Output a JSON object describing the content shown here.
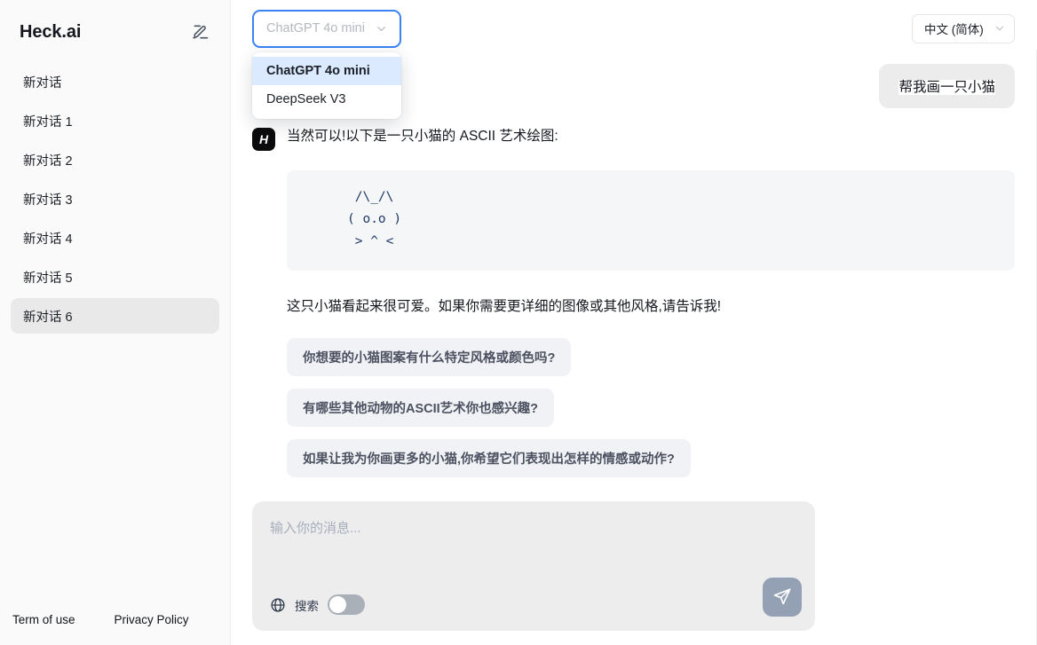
{
  "sidebar": {
    "brand": "Heck.ai",
    "compose_icon": "square-pen-icon",
    "conversations": [
      {
        "label": "新对话",
        "active": false
      },
      {
        "label": "新对话 1",
        "active": false
      },
      {
        "label": "新对话 2",
        "active": false
      },
      {
        "label": "新对话 3",
        "active": false
      },
      {
        "label": "新对话 4",
        "active": false
      },
      {
        "label": "新对话 5",
        "active": false
      },
      {
        "label": "新对话 6",
        "active": true
      }
    ],
    "footer": {
      "terms": "Term of use",
      "privacy": "Privacy Policy"
    }
  },
  "topbar": {
    "model_select": {
      "value": "ChatGPT 4o mini",
      "expanded": true,
      "chevron_icon": "chevron-down-icon",
      "options": [
        {
          "label": "ChatGPT 4o mini",
          "selected": true
        },
        {
          "label": "DeepSeek V3",
          "selected": false
        }
      ]
    },
    "language_select": {
      "value": "中文 (简体)",
      "chevron_icon": "chevron-down-icon"
    }
  },
  "chat": {
    "user_message": "帮我画一只小猫",
    "assistant": {
      "avatar_letter": "H",
      "intro": "当然可以!以下是一只小猫的 ASCII 艺术绘图:",
      "code_block": " /\\_/\\\n( o.o )\n > ^ <",
      "closing": "这只小猫看起来很可爱。如果你需要更详细的图像或其他风格,请告诉我!"
    },
    "suggestions": [
      "你想要的小猫图案有什么特定风格或颜色吗?",
      "有哪些其他动物的ASCII艺术你也感兴趣?",
      "如果让我为你画更多的小猫,你希望它们表现出怎样的情感或动作?"
    ]
  },
  "composer": {
    "placeholder": "输入你的消息...",
    "value": "",
    "globe_icon": "globe-icon",
    "search_label": "搜索",
    "search_enabled": false,
    "send_icon": "send-paper-plane-icon"
  },
  "colors": {
    "accent_border": "#3b82f6",
    "option_highlight": "#dbeafe",
    "send_button": "#94a0b4",
    "code_text": "#1f3a66",
    "sidebar_active": "#e9e9e9"
  }
}
